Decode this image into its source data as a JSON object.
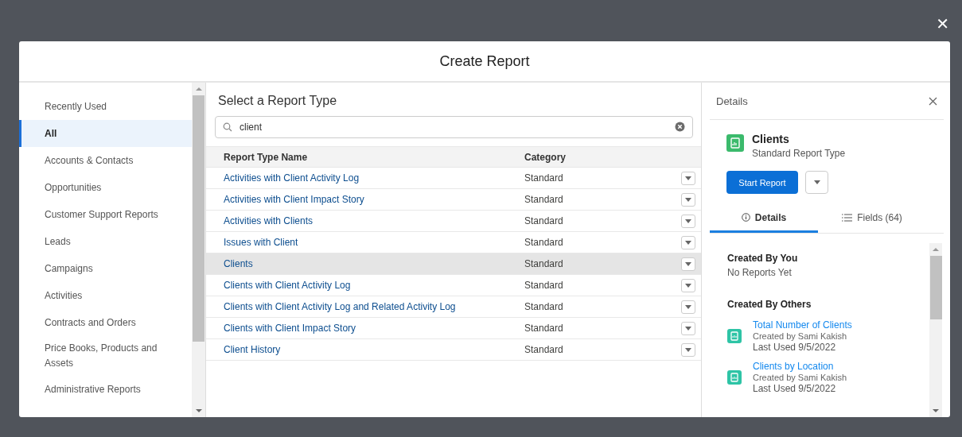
{
  "modal": {
    "title": "Create Report",
    "close_icon": "✕"
  },
  "sidebar": {
    "items": [
      {
        "label": "Recently Used",
        "selected": false
      },
      {
        "label": "All",
        "selected": true
      },
      {
        "label": "Accounts & Contacts",
        "selected": false
      },
      {
        "label": "Opportunities",
        "selected": false
      },
      {
        "label": "Customer Support Reports",
        "selected": false
      },
      {
        "label": "Leads",
        "selected": false
      },
      {
        "label": "Campaigns",
        "selected": false
      },
      {
        "label": "Activities",
        "selected": false
      },
      {
        "label": "Contracts and Orders",
        "selected": false
      },
      {
        "label": "Price Books, Products and Assets",
        "selected": false
      },
      {
        "label": "Administrative Reports",
        "selected": false
      }
    ]
  },
  "main": {
    "title": "Select a Report Type",
    "search": {
      "value": "client"
    },
    "table": {
      "columns": [
        "Report Type Name",
        "Category"
      ],
      "rows": [
        {
          "name": "Activities with Client Activity Log",
          "category": "Standard",
          "selected": false
        },
        {
          "name": "Activities with Client Impact Story",
          "category": "Standard",
          "selected": false
        },
        {
          "name": "Activities with Clients",
          "category": "Standard",
          "selected": false
        },
        {
          "name": "Issues with Client",
          "category": "Standard",
          "selected": false
        },
        {
          "name": "Clients",
          "category": "Standard",
          "selected": true
        },
        {
          "name": "Clients with Client Activity Log",
          "category": "Standard",
          "selected": false
        },
        {
          "name": "Clients with Client Activity Log and Related Activity Log",
          "category": "Standard",
          "selected": false
        },
        {
          "name": "Clients with Client Impact Story",
          "category": "Standard",
          "selected": false
        },
        {
          "name": "Client History",
          "category": "Standard",
          "selected": false
        }
      ]
    }
  },
  "details": {
    "title": "Details",
    "name": "Clients",
    "subtitle": "Standard Report Type",
    "start_button": "Start Report",
    "tabs": [
      {
        "label": "Details",
        "kind": "info",
        "selected": true
      },
      {
        "label": "Fields (64)",
        "kind": "list",
        "selected": false
      }
    ],
    "sections": [
      {
        "heading": "Created By You",
        "empty_text": "No Reports Yet"
      },
      {
        "heading": "Created By Others",
        "reports": [
          {
            "title": "Total Number of Clients",
            "created_by": "Created by Sami Kakish",
            "last_used": "Last Used 9/5/2022"
          },
          {
            "title": "Clients by Location",
            "created_by": "Created by Sami Kakish",
            "last_used": "Last Used 9/5/2022"
          }
        ]
      }
    ]
  }
}
